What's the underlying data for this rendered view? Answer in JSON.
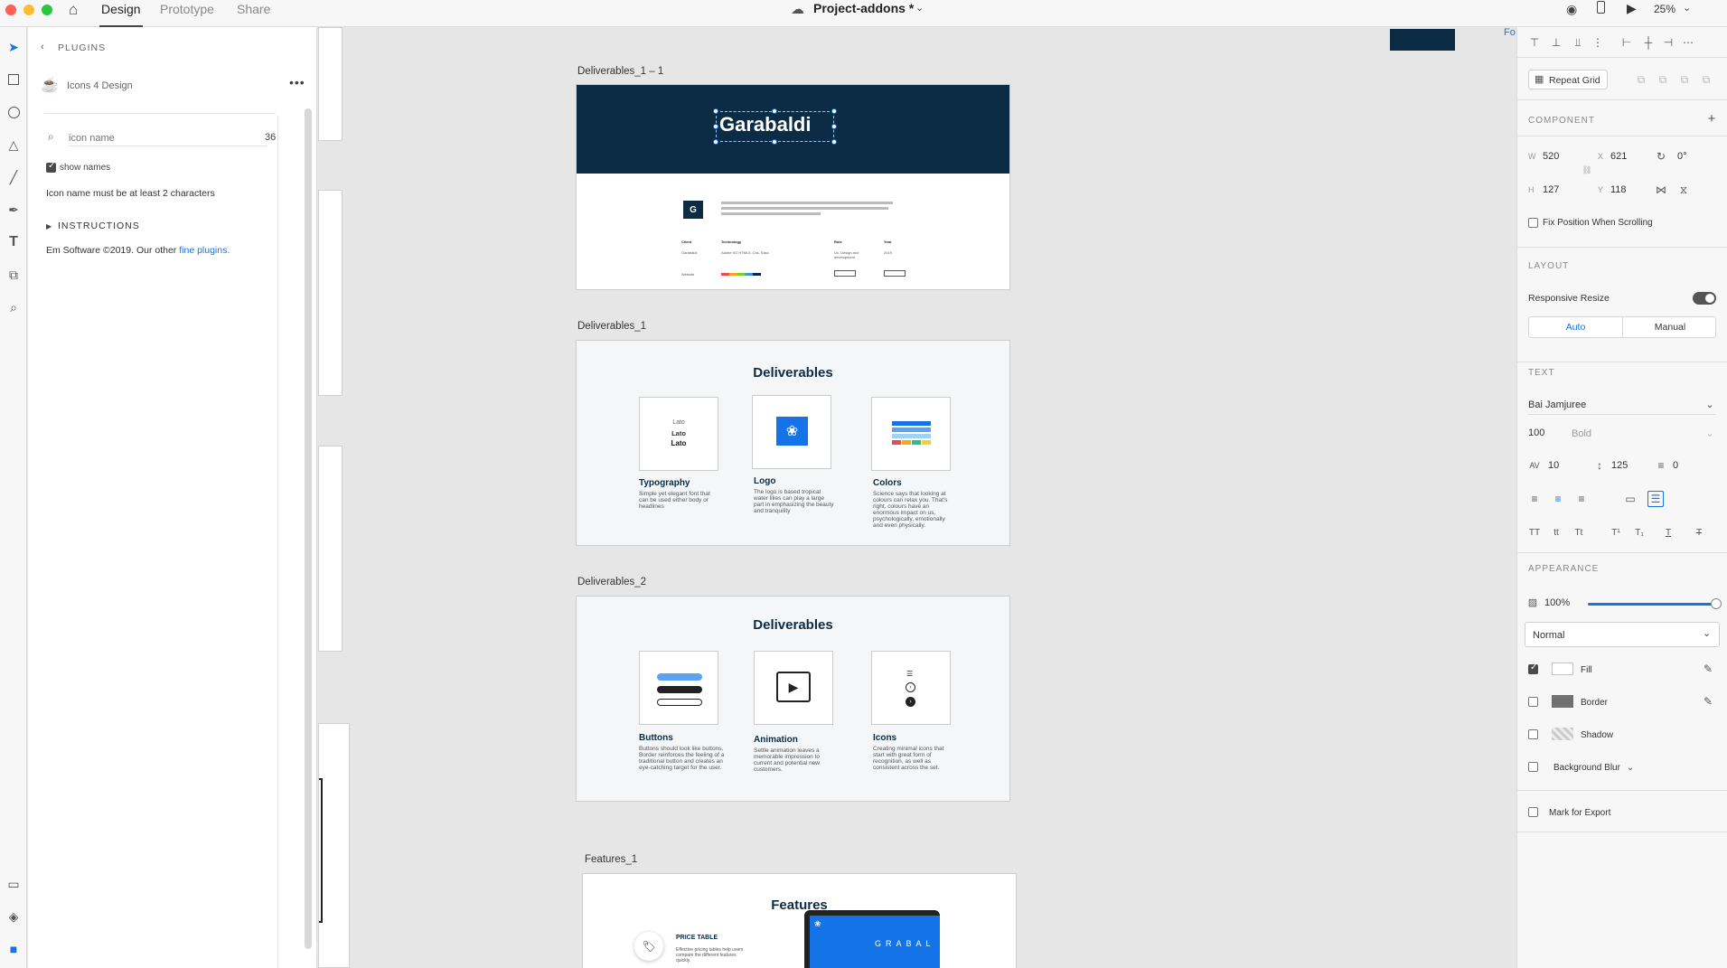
{
  "titlebar": {
    "tabs": [
      "Design",
      "Prototype",
      "Share"
    ],
    "doc_name": "Project-addons *",
    "zoom": "25%"
  },
  "plugins": {
    "back_label": "PLUGINS",
    "plugin_name": "Icons 4 Design",
    "search_placeholder": "icon name",
    "search_count": "36",
    "show_names": "show names",
    "message": "Icon name must be at least 2 characters",
    "instructions": "INSTRUCTIONS",
    "footer_prefix": "Em Software ©2019. Our other ",
    "footer_link": "fine plugins."
  },
  "canvas": {
    "artboards": [
      {
        "label": "Deliverables_1 – 1"
      },
      {
        "label": "Deliverables_1"
      },
      {
        "label": "Deliverables_2"
      },
      {
        "label": "Features_1"
      }
    ],
    "hero": {
      "title": "Garabaldi",
      "badge": "G",
      "cols": [
        "Client",
        "Technology",
        "Role",
        "Year"
      ],
      "cells": [
        "Garabaldi",
        "Adobe XD HTML5, Css, Sass",
        "Ux, Design and development",
        "2019"
      ],
      "website": "Website"
    },
    "deliverables_1": {
      "title": "Deliverables",
      "cards": [
        {
          "title": "Typography",
          "desc": "Simple yet elegant font that can be used either body or headlines",
          "lines": [
            "Lato",
            "Lato",
            "Lato"
          ]
        },
        {
          "title": "Logo",
          "desc": "The logo is based tropical water lilies can play a large part in emphasizing the beauty and tranquility"
        },
        {
          "title": "Colors",
          "desc": "Science says that looking at colours can relax you. That's right, colours have an enormous impact on us, psychologically, emotionally and even physically."
        }
      ]
    },
    "deliverables_2": {
      "title": "Deliverables",
      "cards": [
        {
          "title": "Buttons",
          "desc": "Buttons should look like buttons. Border reinforces the feeling of a traditional button and creates an eye-catching target for the user."
        },
        {
          "title": "Animation",
          "desc": "Settle animation leaves a memorable impression to current and potential new customers."
        },
        {
          "title": "Icons",
          "desc": "Creating minimal icons that start with great form of recognition, as well as consistent across the set."
        }
      ]
    },
    "features": {
      "title": "Features",
      "item_title": "PRICE TABLE",
      "item_desc": "Effective pricing tables help users compare the different features quickly.",
      "device_text": "GRABAL"
    },
    "corner_text": "Fo"
  },
  "props": {
    "repeat_grid": "Repeat Grid",
    "component": "COMPONENT",
    "w": "520",
    "x": "621",
    "rotation": "0°",
    "h": "127",
    "y": "118",
    "fix_position": "Fix Position When Scrolling",
    "layout": "LAYOUT",
    "responsive_resize": "Responsive Resize",
    "auto": "Auto",
    "manual": "Manual",
    "text": "TEXT",
    "font": "Bai Jamjuree",
    "font_size": "100",
    "font_weight": "Bold",
    "char_spacing": "10",
    "line_spacing": "125",
    "para_spacing": "0",
    "appearance": "APPEARANCE",
    "opacity": "100%",
    "opacity_value": 1.0,
    "blend": "Normal",
    "fill": "Fill",
    "border": "Border",
    "shadow": "Shadow",
    "background_blur": "Background Blur",
    "export": "Mark for Export"
  },
  "colors": {
    "navy": "#0b2c44",
    "accent": "#1473e6"
  }
}
